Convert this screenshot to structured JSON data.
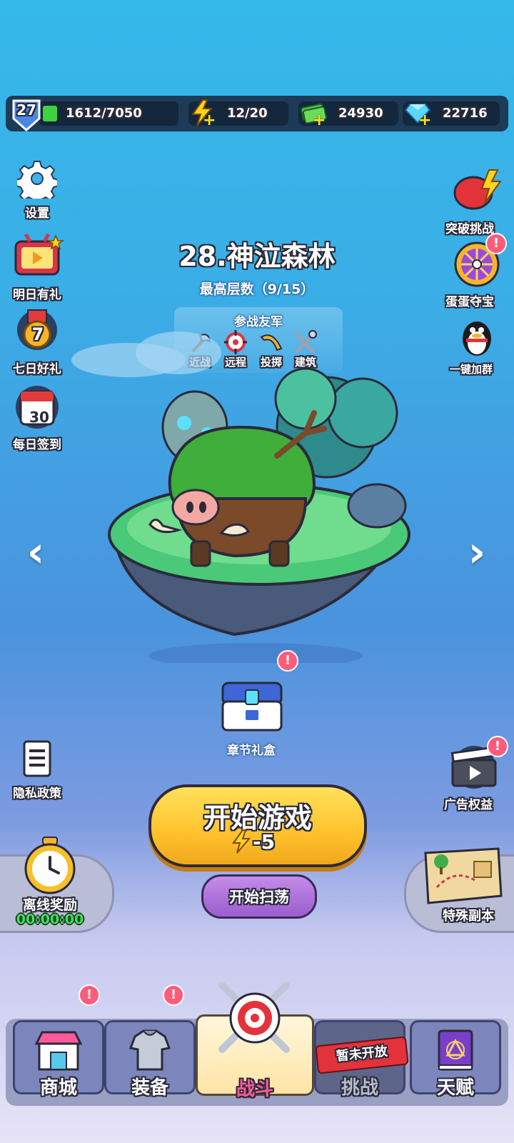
{
  "topbar": {
    "level": "27",
    "xp": "1612/7050",
    "energy": "12/20",
    "cash": "24930",
    "gems": "22716"
  },
  "left_menu": {
    "settings": "设置",
    "tomorrow_gift": "明日有礼",
    "seven_day_gift": "七日好礼",
    "daily_checkin": "每日签到",
    "daily_checkin_day": "30",
    "seven_day_num": "7",
    "privacy": "隐私政策",
    "offline_reward": "离线奖励",
    "offline_timer": "00:00:00"
  },
  "right_menu": {
    "breakthrough": "突破挑战",
    "egg_treasure": "蛋蛋夺宝",
    "join_group": "一键加群",
    "ad_rights": "广告权益",
    "special_dungeon": "特殊副本"
  },
  "stage": {
    "title": "28.神泣森林",
    "highest_floor": "最高层数（9/15）",
    "allies_label": "参战友军",
    "allies": [
      "近战",
      "远程",
      "投掷",
      "建筑"
    ],
    "chapter_box": "章节礼盒"
  },
  "actions": {
    "start_game": "开始游戏",
    "energy_cost": "-5",
    "sweep": "开始扫荡"
  },
  "bottom_nav": {
    "shop": "商城",
    "equipment": "装备",
    "battle": "战斗",
    "challenge": "挑战",
    "talent": "天赋",
    "not_open": "暂未开放"
  },
  "colors": {
    "accent_yellow": "#ffc22c",
    "alert_red": "#ff5b7a",
    "sky_blue": "#35b8ea",
    "purple": "#9a5dd0"
  }
}
